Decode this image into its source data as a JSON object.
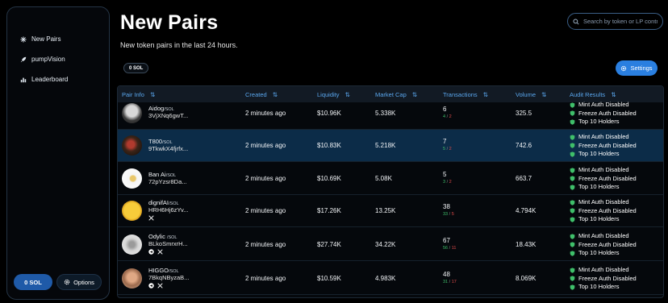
{
  "sidebar": {
    "items": [
      {
        "label": "New Pairs",
        "icon": "sparkle-icon"
      },
      {
        "label": "pumpVision",
        "icon": "rocket-icon"
      },
      {
        "label": "Leaderboard",
        "icon": "bar-chart-icon"
      }
    ],
    "sol_button": "0 SOL",
    "options_button": "Options"
  },
  "header": {
    "title": "New Pairs",
    "subtitle": "New token pairs in the last 24 hours.",
    "search_placeholder": "Search by token or LP contract",
    "sol_chip": "0 SOL",
    "settings_label": "Settings"
  },
  "table": {
    "columns": [
      "Pair Info",
      "Created",
      "Liquidity",
      "Market Cap",
      "Transactions",
      "Volume",
      "Audit Results"
    ],
    "quote": "/SOL",
    "audit_labels": [
      "Mint Auth Disabled",
      "Freeze Auth Disabled",
      "Top 10 Holders"
    ],
    "rows": [
      {
        "name": "Aidog",
        "addr": "3VjXNq6gwT...",
        "created": "2 minutes ago",
        "liquidity": "$10.96K",
        "mcap": "5.338K",
        "tx": "6",
        "buys": "4",
        "sells": "2",
        "volume": "325.5"
      },
      {
        "name": "T800",
        "addr": "9TkwkX4fjrfx...",
        "created": "2 minutes ago",
        "liquidity": "$10.83K",
        "mcap": "5.218K",
        "tx": "7",
        "buys": "5",
        "sells": "2",
        "volume": "742.6"
      },
      {
        "name": "Ban Ai",
        "addr": "72pYzsr8Da...",
        "created": "2 minutes ago",
        "liquidity": "$10.69K",
        "mcap": "5.08K",
        "tx": "5",
        "buys": "3",
        "sells": "2",
        "volume": "663.7"
      },
      {
        "name": "dignifAI",
        "addr": "HRH6Hj6zYv...",
        "created": "2 minutes ago",
        "liquidity": "$17.26K",
        "mcap": "13.25K",
        "tx": "38",
        "buys": "33",
        "sells": "5",
        "volume": "4.794K"
      },
      {
        "name": "Odylic ",
        "addr": "BLkoSmrxrH...",
        "created": "2 minutes ago",
        "liquidity": "$27.74K",
        "mcap": "34.22K",
        "tx": "67",
        "buys": "56",
        "sells": "11",
        "volume": "18.43K"
      },
      {
        "name": "HIGGO",
        "addr": "7BkqNByzaB...",
        "created": "2 minutes ago",
        "liquidity": "$10.59K",
        "mcap": "4.983K",
        "tx": "48",
        "buys": "31",
        "sells": "17",
        "volume": "8.069K"
      }
    ]
  },
  "colors": {
    "accent": "#2a7fe0",
    "header_text": "#5aa7ee",
    "buy": "#3fbf6a",
    "sell": "#e04b4b",
    "selected_row": "#0c2c48"
  }
}
